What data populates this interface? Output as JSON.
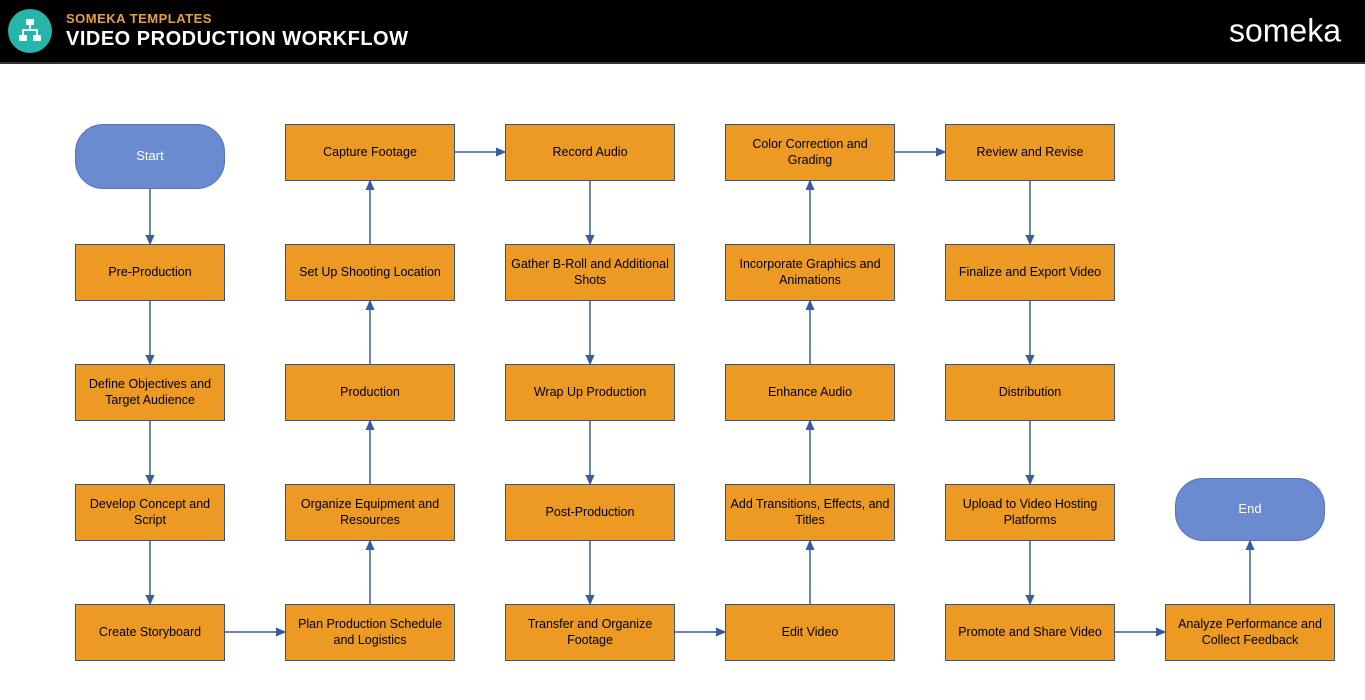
{
  "header": {
    "brand": "SOMEKA TEMPLATES",
    "title": "VIDEO PRODUCTION WORKFLOW",
    "logo_text": "someka"
  },
  "nodes": {
    "start": "Start",
    "end": "End",
    "c1r2": "Pre-Production",
    "c1r3": "Define Objectives and Target Audience",
    "c1r4": "Develop Concept and Script",
    "c1r5": "Create Storyboard",
    "c2r1": "Capture Footage",
    "c2r2": "Set Up Shooting Location",
    "c2r3": "Production",
    "c2r4": "Organize Equipment and Resources",
    "c2r5": "Plan Production Schedule and Logistics",
    "c3r1": "Record Audio",
    "c3r2": "Gather B-Roll and Additional Shots",
    "c3r3": "Wrap Up Production",
    "c3r4": "Post-Production",
    "c3r5": "Transfer and Organize Footage",
    "c4r1": "Color Correction and Grading",
    "c4r2": "Incorporate Graphics and Animations",
    "c4r3": "Enhance Audio",
    "c4r4": "Add Transitions, Effects, and Titles",
    "c4r5": "Edit Video",
    "c5r1": "Review and Revise",
    "c5r2": "Finalize and Export Video",
    "c5r3": "Distribution",
    "c5r4": "Upload to Video Hosting Platforms",
    "c5r5": "Promote and Share Video",
    "c6r5": "Analyze Performance and Collect Feedback"
  },
  "colors": {
    "node_fill": "#ed9a24",
    "node_border": "#2f5597",
    "terminal_fill": "#6b8bd0",
    "arrow": "#3b5da0"
  }
}
